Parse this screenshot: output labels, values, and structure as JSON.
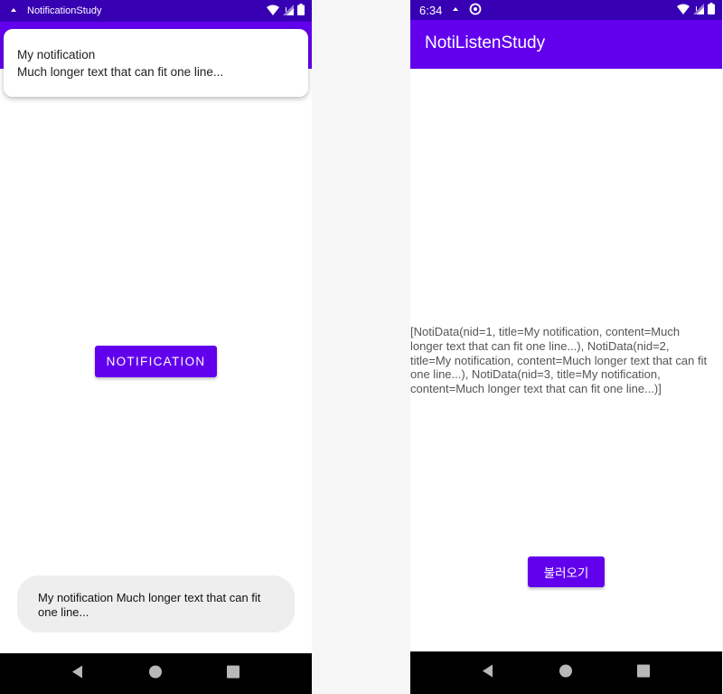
{
  "left_screen": {
    "status_bar": {
      "app_title": "NotificationStudy",
      "icons": [
        "notification-arrow-icon",
        "wifi-icon",
        "signal-icon",
        "battery-icon"
      ]
    },
    "heads_up_notification": {
      "title": "My notification",
      "content": "Much longer text that can fit one line..."
    },
    "notification_button_label": "NOTIFICATION",
    "toast_text": "My notification Much longer text that can fit one line...",
    "nav_bar": {
      "icons": [
        "back-icon",
        "home-icon",
        "recents-icon"
      ]
    }
  },
  "right_screen": {
    "status_bar": {
      "time": "6:34",
      "icons": [
        "notification-arrow-icon",
        "sync-icon",
        "wifi-icon",
        "signal-icon",
        "battery-icon"
      ]
    },
    "app_bar_title": "NotiListenStudy",
    "notification_list_text": "[NotiData(nid=1, title=My notification, content=Much longer text that can fit one line...), NotiData(nid=2, title=My notification, content=Much longer text that can fit one line...), NotiData(nid=3, title=My notification, content=Much longer text that can fit one line...)]",
    "load_button_label": "불러오기",
    "nav_bar": {
      "icons": [
        "back-icon",
        "home-icon",
        "recents-icon"
      ]
    }
  },
  "colors": {
    "status_bar": "#3700b3",
    "app_bar": "#6200ee",
    "button": "#6200ee",
    "nav_bar": "#000000",
    "toast": "#eeeeee",
    "background_gap": "#f6f6f6"
  }
}
